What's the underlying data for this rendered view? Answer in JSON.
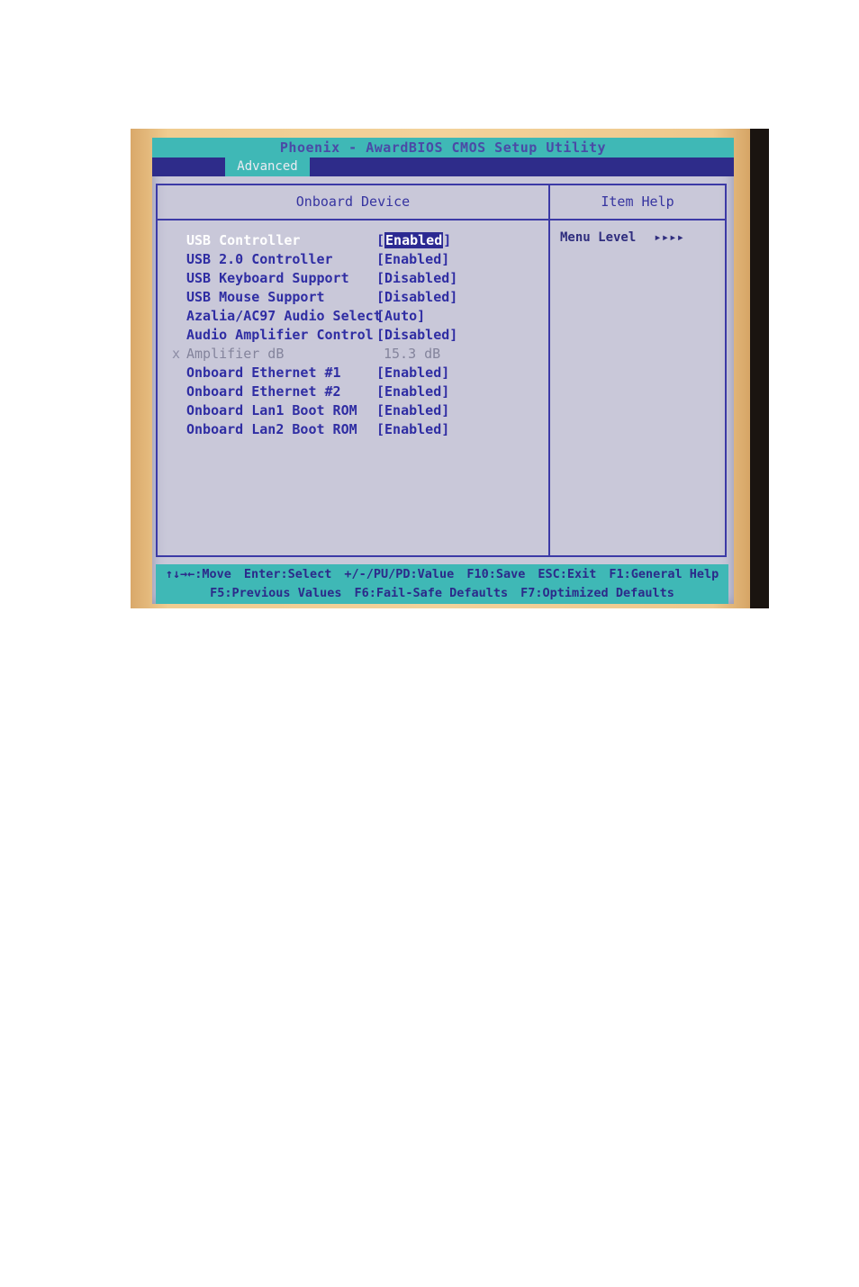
{
  "bios": {
    "title": "Phoenix - AwardBIOS CMOS Setup Utility",
    "active_tab": "Advanced",
    "left_panel_title": "Onboard Device",
    "right_panel_title": "Item Help",
    "items": [
      {
        "label": "USB Controller",
        "value": "[Enabled]",
        "state": "selected"
      },
      {
        "label": "USB 2.0 Controller",
        "value": "[Enabled]",
        "state": "normal"
      },
      {
        "label": "USB Keyboard Support",
        "value": "[Disabled]",
        "state": "normal"
      },
      {
        "label": "USB Mouse Support",
        "value": "[Disabled]",
        "state": "normal"
      },
      {
        "label": "Azalia/AC97 Audio Select",
        "value": "[Auto]",
        "state": "normal"
      },
      {
        "label": "Audio Amplifier Control",
        "value": "[Disabled]",
        "state": "normal"
      },
      {
        "label": "Amplifier dB",
        "value": "15.3 dB",
        "state": "disabled",
        "marker": "x"
      },
      {
        "label": "Onboard Ethernet #1",
        "value": "[Enabled]",
        "state": "normal"
      },
      {
        "label": "Onboard Ethernet #2",
        "value": "[Enabled]",
        "state": "normal"
      },
      {
        "label": "Onboard Lan1 Boot ROM",
        "value": "[Enabled]",
        "state": "normal"
      },
      {
        "label": "Onboard Lan2 Boot ROM",
        "value": "[Enabled]",
        "state": "normal"
      }
    ],
    "help": {
      "menu_level_label": "Menu Level",
      "menu_level_value": "▸▸▸▸"
    },
    "footer": {
      "line1": [
        "↑↓→←:Move",
        "Enter:Select",
        "+/-/PU/PD:Value",
        "F10:Save",
        "ESC:Exit",
        "F1:General Help"
      ],
      "line2": [
        "F5:Previous Values",
        "F6:Fail-Safe Defaults",
        "F7:Optimized Defaults"
      ]
    }
  }
}
